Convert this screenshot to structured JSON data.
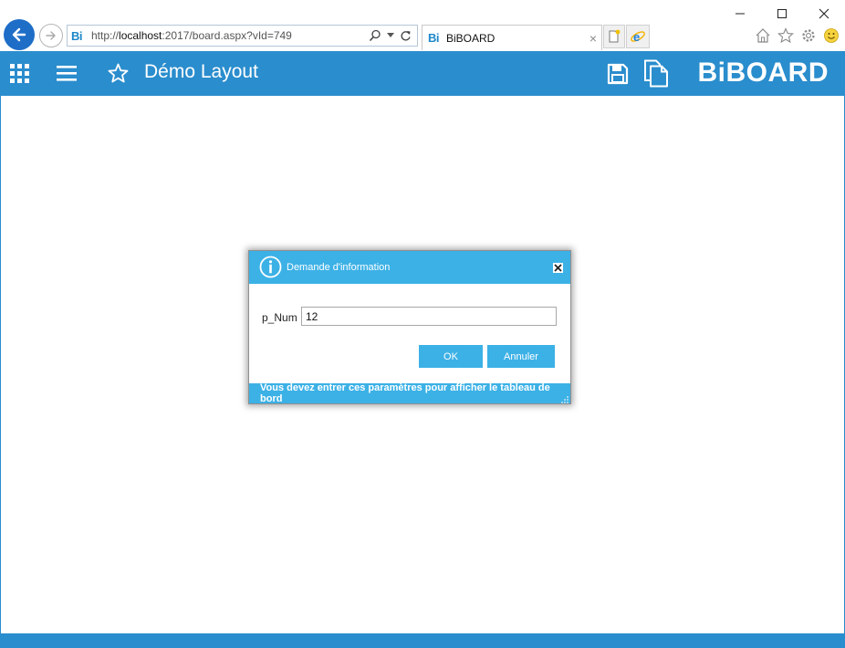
{
  "browser": {
    "url_prefix": "http://",
    "url_host": "localhost",
    "url_rest": ":2017/board.aspx?vId=749",
    "favicon_text": "Bi",
    "tab_title": "BiBOARD",
    "tab_close": "×"
  },
  "app": {
    "page_title": "Démo Layout",
    "brand": "BiBOARD",
    "accent_color": "#2a8dcd"
  },
  "dialog": {
    "title": "Demande d'information",
    "param_label": "p_Num",
    "param_value": "12",
    "ok_label": "OK",
    "cancel_label": "Annuler",
    "footer_message": "Vous devez entrer ces paramètres pour afficher le tableau de bord",
    "header_color": "#3cb1e6"
  },
  "icons": {
    "window": [
      "minimize-icon",
      "maximize-icon",
      "close-icon"
    ],
    "appbar": [
      "apps-grid-icon",
      "menu-icon",
      "favorite-star-icon",
      "save-icon",
      "copy-icon"
    ],
    "browser_tools": [
      "home-icon",
      "favorites-icon",
      "settings-gear-icon",
      "smiley-icon"
    ]
  }
}
